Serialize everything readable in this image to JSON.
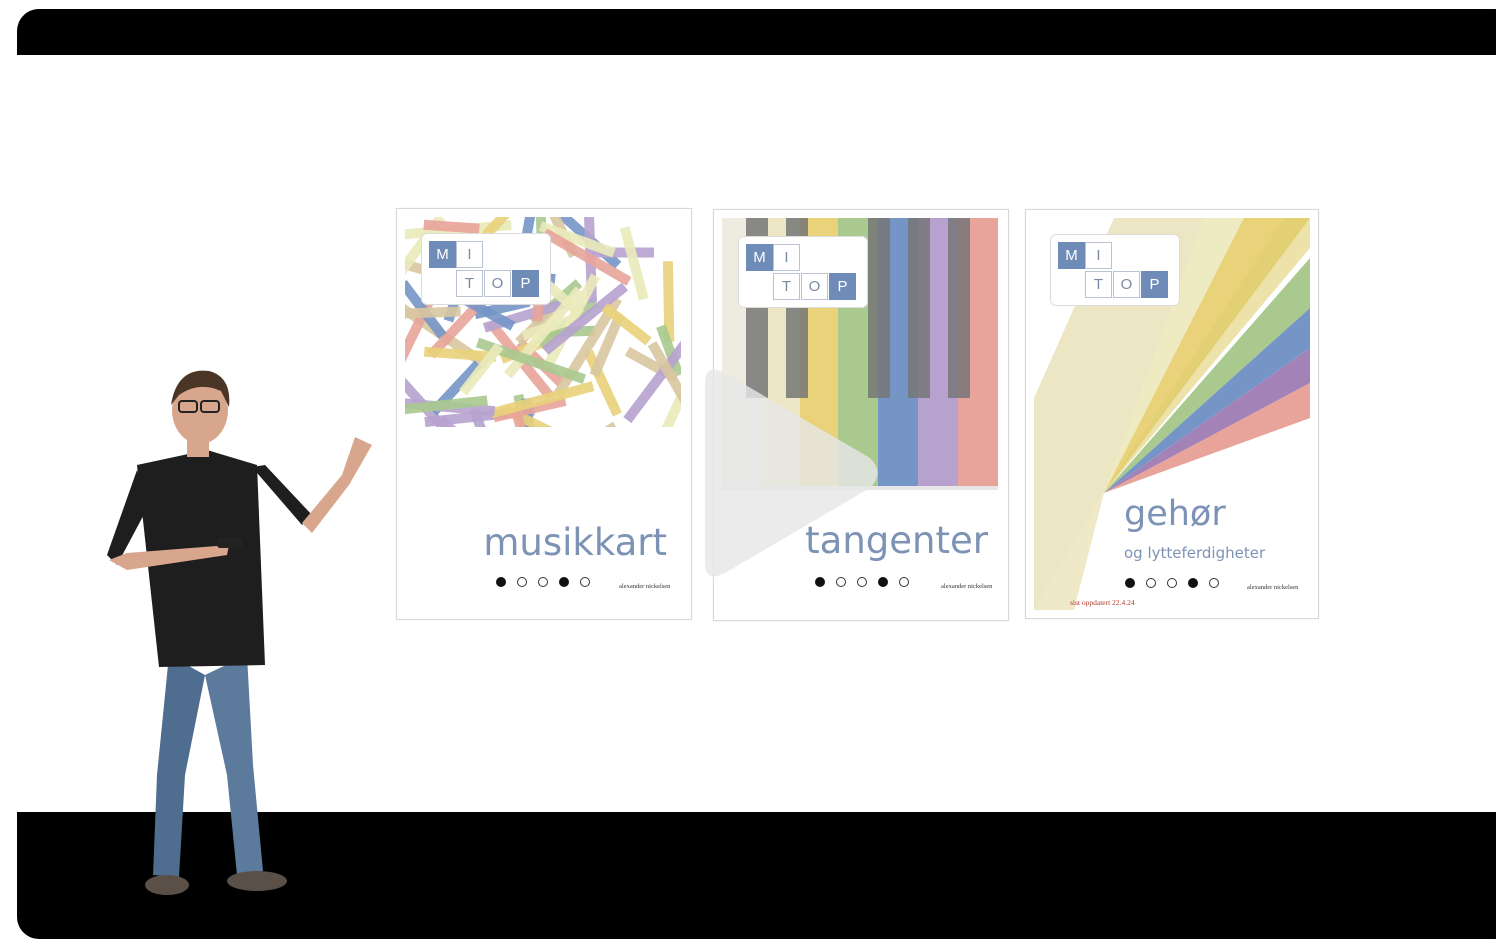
{
  "player": {
    "play_icon": "play-icon"
  },
  "books": [
    {
      "title": "musikkart",
      "logo": [
        "M",
        "I",
        "T",
        "O",
        "P"
      ],
      "dots": [
        1,
        0,
        0,
        1,
        0
      ],
      "author": "alexander nickelsen"
    },
    {
      "title": "tangenter",
      "logo": [
        "M",
        "I",
        "T",
        "O",
        "P"
      ],
      "dots": [
        1,
        0,
        0,
        1,
        0
      ],
      "author": "alexander nickelsen"
    },
    {
      "title": "gehør",
      "subtitle": "og lytteferdigheter",
      "logo": [
        "M",
        "I",
        "T",
        "O",
        "P"
      ],
      "dots": [
        1,
        0,
        0,
        1,
        0
      ],
      "author": "alexander nickelsen",
      "updated": "sist oppdatert 22.4.24"
    }
  ],
  "colors": {
    "brand_blue": "#6f8cb8",
    "title_blue": "#7d93b6",
    "update_red": "#b23a2a",
    "palette": [
      "#e8a49a",
      "#e9d27a",
      "#a9c98f",
      "#7595c6",
      "#b7a2cf",
      "#eaeaba",
      "#d8c7a0"
    ]
  }
}
